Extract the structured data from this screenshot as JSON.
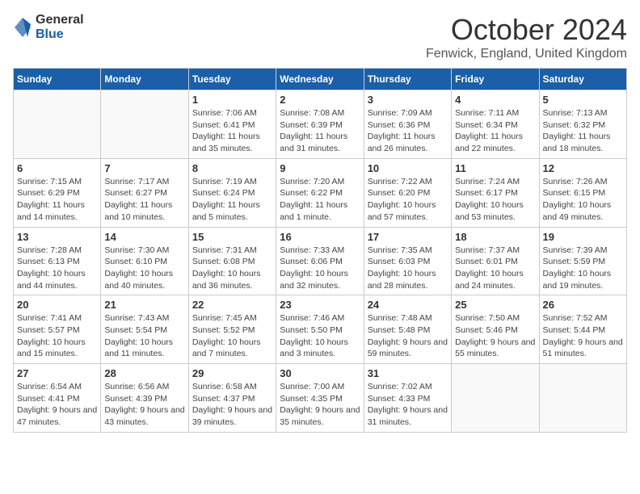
{
  "logo": {
    "general": "General",
    "blue": "Blue"
  },
  "title": "October 2024",
  "location": "Fenwick, England, United Kingdom",
  "days_of_week": [
    "Sunday",
    "Monday",
    "Tuesday",
    "Wednesday",
    "Thursday",
    "Friday",
    "Saturday"
  ],
  "weeks": [
    [
      {
        "day": "",
        "sunrise": "",
        "sunset": "",
        "daylight": ""
      },
      {
        "day": "",
        "sunrise": "",
        "sunset": "",
        "daylight": ""
      },
      {
        "day": "1",
        "sunrise": "Sunrise: 7:06 AM",
        "sunset": "Sunset: 6:41 PM",
        "daylight": "Daylight: 11 hours and 35 minutes."
      },
      {
        "day": "2",
        "sunrise": "Sunrise: 7:08 AM",
        "sunset": "Sunset: 6:39 PM",
        "daylight": "Daylight: 11 hours and 31 minutes."
      },
      {
        "day": "3",
        "sunrise": "Sunrise: 7:09 AM",
        "sunset": "Sunset: 6:36 PM",
        "daylight": "Daylight: 11 hours and 26 minutes."
      },
      {
        "day": "4",
        "sunrise": "Sunrise: 7:11 AM",
        "sunset": "Sunset: 6:34 PM",
        "daylight": "Daylight: 11 hours and 22 minutes."
      },
      {
        "day": "5",
        "sunrise": "Sunrise: 7:13 AM",
        "sunset": "Sunset: 6:32 PM",
        "daylight": "Daylight: 11 hours and 18 minutes."
      }
    ],
    [
      {
        "day": "6",
        "sunrise": "Sunrise: 7:15 AM",
        "sunset": "Sunset: 6:29 PM",
        "daylight": "Daylight: 11 hours and 14 minutes."
      },
      {
        "day": "7",
        "sunrise": "Sunrise: 7:17 AM",
        "sunset": "Sunset: 6:27 PM",
        "daylight": "Daylight: 11 hours and 10 minutes."
      },
      {
        "day": "8",
        "sunrise": "Sunrise: 7:19 AM",
        "sunset": "Sunset: 6:24 PM",
        "daylight": "Daylight: 11 hours and 5 minutes."
      },
      {
        "day": "9",
        "sunrise": "Sunrise: 7:20 AM",
        "sunset": "Sunset: 6:22 PM",
        "daylight": "Daylight: 11 hours and 1 minute."
      },
      {
        "day": "10",
        "sunrise": "Sunrise: 7:22 AM",
        "sunset": "Sunset: 6:20 PM",
        "daylight": "Daylight: 10 hours and 57 minutes."
      },
      {
        "day": "11",
        "sunrise": "Sunrise: 7:24 AM",
        "sunset": "Sunset: 6:17 PM",
        "daylight": "Daylight: 10 hours and 53 minutes."
      },
      {
        "day": "12",
        "sunrise": "Sunrise: 7:26 AM",
        "sunset": "Sunset: 6:15 PM",
        "daylight": "Daylight: 10 hours and 49 minutes."
      }
    ],
    [
      {
        "day": "13",
        "sunrise": "Sunrise: 7:28 AM",
        "sunset": "Sunset: 6:13 PM",
        "daylight": "Daylight: 10 hours and 44 minutes."
      },
      {
        "day": "14",
        "sunrise": "Sunrise: 7:30 AM",
        "sunset": "Sunset: 6:10 PM",
        "daylight": "Daylight: 10 hours and 40 minutes."
      },
      {
        "day": "15",
        "sunrise": "Sunrise: 7:31 AM",
        "sunset": "Sunset: 6:08 PM",
        "daylight": "Daylight: 10 hours and 36 minutes."
      },
      {
        "day": "16",
        "sunrise": "Sunrise: 7:33 AM",
        "sunset": "Sunset: 6:06 PM",
        "daylight": "Daylight: 10 hours and 32 minutes."
      },
      {
        "day": "17",
        "sunrise": "Sunrise: 7:35 AM",
        "sunset": "Sunset: 6:03 PM",
        "daylight": "Daylight: 10 hours and 28 minutes."
      },
      {
        "day": "18",
        "sunrise": "Sunrise: 7:37 AM",
        "sunset": "Sunset: 6:01 PM",
        "daylight": "Daylight: 10 hours and 24 minutes."
      },
      {
        "day": "19",
        "sunrise": "Sunrise: 7:39 AM",
        "sunset": "Sunset: 5:59 PM",
        "daylight": "Daylight: 10 hours and 19 minutes."
      }
    ],
    [
      {
        "day": "20",
        "sunrise": "Sunrise: 7:41 AM",
        "sunset": "Sunset: 5:57 PM",
        "daylight": "Daylight: 10 hours and 15 minutes."
      },
      {
        "day": "21",
        "sunrise": "Sunrise: 7:43 AM",
        "sunset": "Sunset: 5:54 PM",
        "daylight": "Daylight: 10 hours and 11 minutes."
      },
      {
        "day": "22",
        "sunrise": "Sunrise: 7:45 AM",
        "sunset": "Sunset: 5:52 PM",
        "daylight": "Daylight: 10 hours and 7 minutes."
      },
      {
        "day": "23",
        "sunrise": "Sunrise: 7:46 AM",
        "sunset": "Sunset: 5:50 PM",
        "daylight": "Daylight: 10 hours and 3 minutes."
      },
      {
        "day": "24",
        "sunrise": "Sunrise: 7:48 AM",
        "sunset": "Sunset: 5:48 PM",
        "daylight": "Daylight: 9 hours and 59 minutes."
      },
      {
        "day": "25",
        "sunrise": "Sunrise: 7:50 AM",
        "sunset": "Sunset: 5:46 PM",
        "daylight": "Daylight: 9 hours and 55 minutes."
      },
      {
        "day": "26",
        "sunrise": "Sunrise: 7:52 AM",
        "sunset": "Sunset: 5:44 PM",
        "daylight": "Daylight: 9 hours and 51 minutes."
      }
    ],
    [
      {
        "day": "27",
        "sunrise": "Sunrise: 6:54 AM",
        "sunset": "Sunset: 4:41 PM",
        "daylight": "Daylight: 9 hours and 47 minutes."
      },
      {
        "day": "28",
        "sunrise": "Sunrise: 6:56 AM",
        "sunset": "Sunset: 4:39 PM",
        "daylight": "Daylight: 9 hours and 43 minutes."
      },
      {
        "day": "29",
        "sunrise": "Sunrise: 6:58 AM",
        "sunset": "Sunset: 4:37 PM",
        "daylight": "Daylight: 9 hours and 39 minutes."
      },
      {
        "day": "30",
        "sunrise": "Sunrise: 7:00 AM",
        "sunset": "Sunset: 4:35 PM",
        "daylight": "Daylight: 9 hours and 35 minutes."
      },
      {
        "day": "31",
        "sunrise": "Sunrise: 7:02 AM",
        "sunset": "Sunset: 4:33 PM",
        "daylight": "Daylight: 9 hours and 31 minutes."
      },
      {
        "day": "",
        "sunrise": "",
        "sunset": "",
        "daylight": ""
      },
      {
        "day": "",
        "sunrise": "",
        "sunset": "",
        "daylight": ""
      }
    ]
  ]
}
